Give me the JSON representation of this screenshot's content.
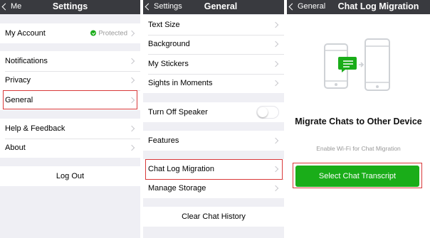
{
  "screen1": {
    "back": "Me",
    "title": "Settings",
    "my_account": "My Account",
    "protected": "Protected",
    "notifications": "Notifications",
    "privacy": "Privacy",
    "general": "General",
    "help": "Help & Feedback",
    "about": "About",
    "logout": "Log Out"
  },
  "screen2": {
    "back": "Settings",
    "title": "General",
    "text_size": "Text Size",
    "background": "Background",
    "stickers": "My Stickers",
    "sights": "Sights in Moments",
    "turn_off_speaker": "Turn Off Speaker",
    "speaker_toggle_on": false,
    "features": "Features",
    "chat_log_migration": "Chat Log Migration",
    "manage_storage": "Manage Storage",
    "clear_history": "Clear Chat History"
  },
  "screen3": {
    "back": "General",
    "title": "Chat Log Migration",
    "heading": "Migrate Chats to Other Device",
    "subtitle": "Enable Wi-Fi for Chat Migration",
    "button": "Select Chat Transcript"
  },
  "colors": {
    "navbar": "#393a3f",
    "accent_green": "#1aad19",
    "highlight_red": "#d9393a"
  }
}
